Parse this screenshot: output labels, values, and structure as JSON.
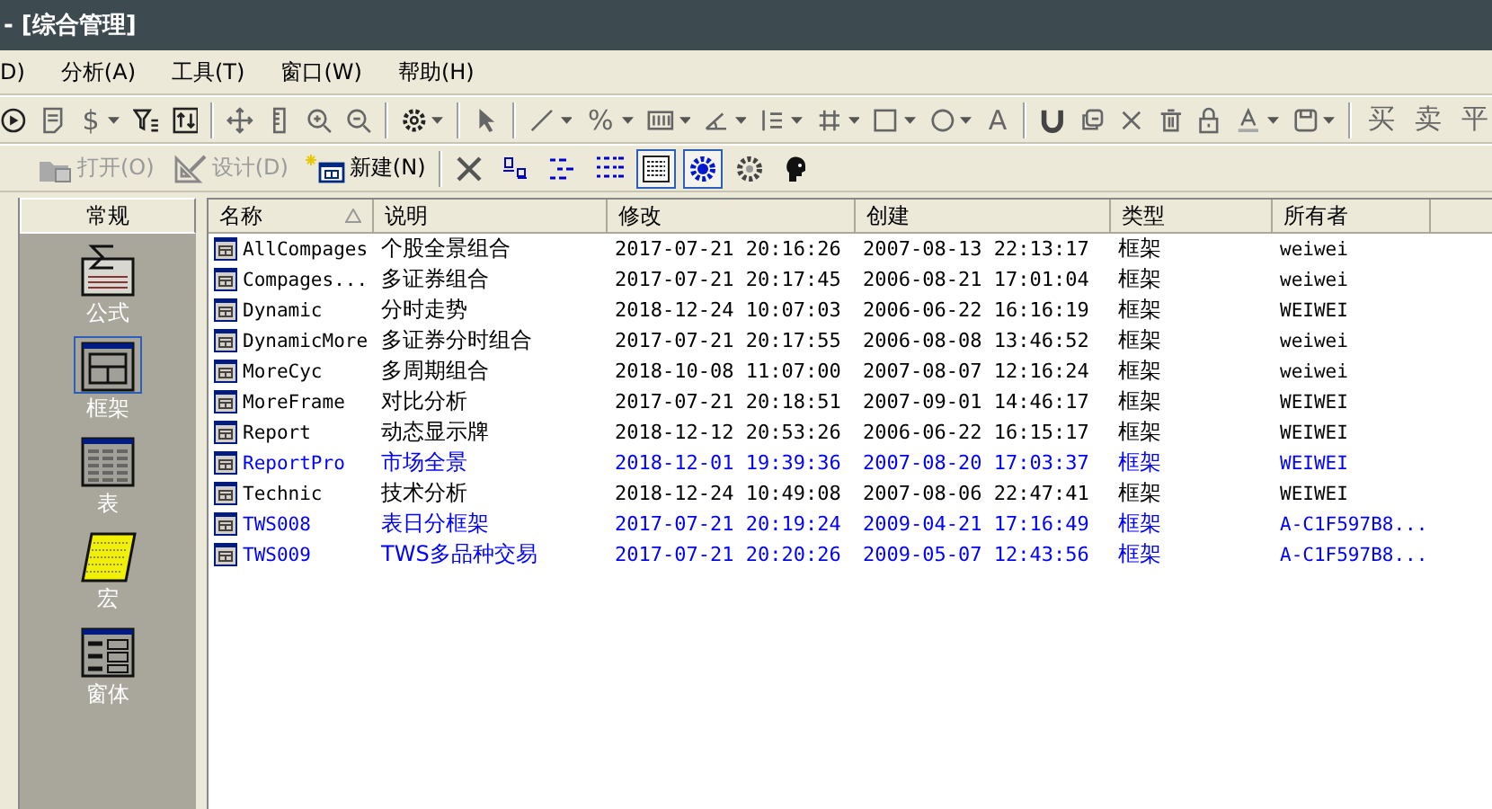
{
  "window": {
    "title": "- [综合管理]"
  },
  "menu": [
    "D)",
    "分析(A)",
    "工具(T)",
    "窗口(W)",
    "帮助(H)"
  ],
  "toolbar": [
    {
      "kind": "play"
    },
    {
      "kind": "doc"
    },
    {
      "kind": "glyph",
      "label": "$"
    },
    {
      "kind": "dd"
    },
    {
      "kind": "filter"
    },
    {
      "kind": "sort"
    },
    {
      "kind": "sep"
    },
    {
      "kind": "move"
    },
    {
      "kind": "ruler"
    },
    {
      "kind": "zoom-in"
    },
    {
      "kind": "zoom-out"
    },
    {
      "kind": "sep"
    },
    {
      "kind": "gear"
    },
    {
      "kind": "dd"
    },
    {
      "kind": "sep"
    },
    {
      "kind": "cursor"
    },
    {
      "kind": "sep"
    },
    {
      "kind": "line"
    },
    {
      "kind": "dd"
    },
    {
      "kind": "glyph",
      "label": "%"
    },
    {
      "kind": "dd"
    },
    {
      "kind": "bars"
    },
    {
      "kind": "dd"
    },
    {
      "kind": "angle"
    },
    {
      "kind": "dd"
    },
    {
      "kind": "list"
    },
    {
      "kind": "dd"
    },
    {
      "kind": "hash"
    },
    {
      "kind": "dd"
    },
    {
      "kind": "rect"
    },
    {
      "kind": "dd"
    },
    {
      "kind": "circle"
    },
    {
      "kind": "dd"
    },
    {
      "kind": "glyph",
      "label": "A"
    },
    {
      "kind": "sep"
    },
    {
      "kind": "magnet"
    },
    {
      "kind": "copy"
    },
    {
      "kind": "x"
    },
    {
      "kind": "trash"
    },
    {
      "kind": "lock"
    },
    {
      "kind": "color"
    },
    {
      "kind": "dd"
    },
    {
      "kind": "save"
    },
    {
      "kind": "dd"
    },
    {
      "kind": "sep"
    },
    {
      "kind": "glyph",
      "label": "买"
    },
    {
      "kind": "glyph",
      "label": "卖"
    },
    {
      "kind": "glyph",
      "label": "平"
    }
  ],
  "actions": [
    {
      "kind": "open",
      "label": "打开(O)",
      "disabled": true
    },
    {
      "kind": "design",
      "label": "设计(D)",
      "disabled": true
    },
    {
      "kind": "new",
      "label": "新建(N)",
      "disabled": false
    }
  ],
  "view_buttons": [
    {
      "kind": "delete",
      "selected": false
    },
    {
      "kind": "large",
      "selected": false
    },
    {
      "kind": "small",
      "selected": false
    },
    {
      "kind": "list",
      "selected": false
    },
    {
      "kind": "details",
      "selected": true
    },
    {
      "kind": "gear-blue",
      "selected": true
    },
    {
      "kind": "gear",
      "selected": false
    },
    {
      "kind": "head",
      "selected": false
    }
  ],
  "sidebar": {
    "title": "常规",
    "items": [
      {
        "kind": "formula",
        "label": "公式",
        "selected": false
      },
      {
        "kind": "frame",
        "label": "框架",
        "selected": true
      },
      {
        "kind": "table",
        "label": "表",
        "selected": false
      },
      {
        "kind": "macro",
        "label": "宏",
        "selected": false
      },
      {
        "kind": "form",
        "label": "窗体",
        "selected": false
      }
    ]
  },
  "table": {
    "columns": [
      {
        "label": "名称",
        "sorted": true
      },
      {
        "label": "说明",
        "sorted": false
      },
      {
        "label": "修改",
        "sorted": false
      },
      {
        "label": "创建",
        "sorted": false
      },
      {
        "label": "类型",
        "sorted": false
      },
      {
        "label": "所有者",
        "sorted": false
      }
    ],
    "rows": [
      {
        "cells": [
          "AllCompages",
          "个股全景组合",
          "2017-07-21 20:16:26",
          "2007-08-13 22:13:17",
          "框架",
          "weiwei"
        ],
        "highlighted": false
      },
      {
        "cells": [
          "Compages...",
          "多证券组合",
          "2017-07-21 20:17:45",
          "2006-08-21 17:01:04",
          "框架",
          "weiwei"
        ],
        "highlighted": false
      },
      {
        "cells": [
          "Dynamic",
          "分时走势",
          "2018-12-24 10:07:03",
          "2006-06-22 16:16:19",
          "框架",
          "WEIWEI"
        ],
        "highlighted": false
      },
      {
        "cells": [
          "DynamicMore",
          "多证券分时组合",
          "2017-07-21 20:17:55",
          "2006-08-08 13:46:52",
          "框架",
          "weiwei"
        ],
        "highlighted": false
      },
      {
        "cells": [
          "MoreCyc",
          "多周期组合",
          "2018-10-08 11:07:00",
          "2007-08-07 12:16:24",
          "框架",
          "weiwei"
        ],
        "highlighted": false
      },
      {
        "cells": [
          "MoreFrame",
          "对比分析",
          "2017-07-21 20:18:51",
          "2007-09-01 14:46:17",
          "框架",
          "WEIWEI"
        ],
        "highlighted": false
      },
      {
        "cells": [
          "Report",
          "动态显示牌",
          "2018-12-12 20:53:26",
          "2006-06-22 16:15:17",
          "框架",
          "WEIWEI"
        ],
        "highlighted": false
      },
      {
        "cells": [
          "ReportPro",
          "市场全景",
          "2018-12-01 19:39:36",
          "2007-08-20 17:03:37",
          "框架",
          "WEIWEI"
        ],
        "highlighted": true
      },
      {
        "cells": [
          "Technic",
          "技术分析",
          "2018-12-24 10:49:08",
          "2007-08-06 22:47:41",
          "框架",
          "WEIWEI"
        ],
        "highlighted": false
      },
      {
        "cells": [
          "TWS008",
          "表日分框架",
          "2017-07-21 20:19:24",
          "2009-04-21 17:16:49",
          "框架",
          "A-C1F597B8..."
        ],
        "highlighted": true
      },
      {
        "cells": [
          "TWS009",
          "TWS多品种交易",
          "2017-07-21 20:20:26",
          "2009-05-07 12:43:56",
          "框架",
          "A-C1F597B8..."
        ],
        "highlighted": true
      }
    ]
  }
}
